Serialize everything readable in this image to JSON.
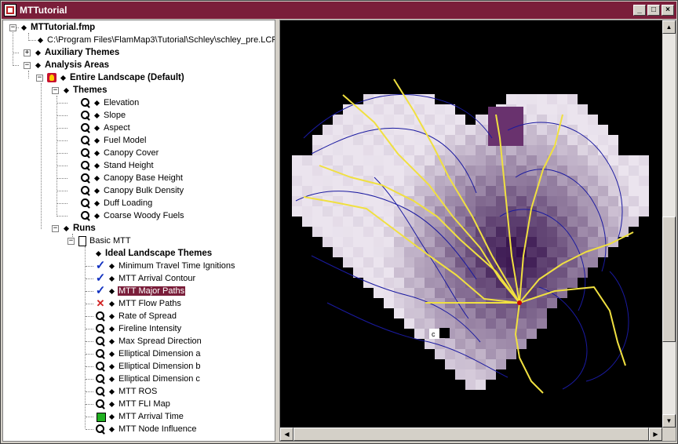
{
  "window": {
    "title": "MTTutorial",
    "controls": {
      "minimize": "_",
      "maximize": "□",
      "close": "×"
    }
  },
  "tree": {
    "root": "MTTutorial.fmp",
    "lcp_path": "C:\\Program Files\\FlamMap3\\Tutorial\\Schley\\schley_pre.LCP",
    "auxiliary_themes": "Auxiliary Themes",
    "analysis_areas": "Analysis Areas",
    "entire_landscape": "Entire Landscape (Default)",
    "themes_label": "Themes",
    "themes": [
      "Elevation",
      "Slope",
      "Aspect",
      "Fuel Model",
      "Canopy Cover",
      "Stand Height",
      "Canopy Base Height",
      "Canopy Bulk Density",
      "Duff Loading",
      "Coarse Woody Fuels"
    ],
    "runs_label": "Runs",
    "run_name": "Basic MTT",
    "ideal_label": "Ideal Landscape Themes",
    "outputs": [
      {
        "label": "Minimum Travel Time Ignitions",
        "icon": "check-icon"
      },
      {
        "label": "MTT Arrival Contour",
        "icon": "check-icon"
      },
      {
        "label": "MTT Major Paths",
        "icon": "check-icon",
        "selected": true
      },
      {
        "label": "MTT Flow Paths",
        "icon": "cross-icon"
      },
      {
        "label": "Rate of Spread",
        "icon": "magnifier-icon"
      },
      {
        "label": "Fireline Intensity",
        "icon": "magnifier-icon"
      },
      {
        "label": "Max Spread Direction",
        "icon": "magnifier-icon"
      },
      {
        "label": "Elliptical Dimension a",
        "icon": "magnifier-icon"
      },
      {
        "label": "Elliptical Dimension b",
        "icon": "magnifier-icon"
      },
      {
        "label": "Elliptical Dimension c",
        "icon": "magnifier-icon"
      },
      {
        "label": "MTT ROS",
        "icon": "magnifier-icon"
      },
      {
        "label": "MTT FLI Map",
        "icon": "magnifier-icon"
      },
      {
        "label": "MTT Arrival Time",
        "icon": "green-square-icon"
      },
      {
        "label": "MTT Node Influence",
        "icon": "magnifier-icon"
      }
    ]
  },
  "map": {
    "colors": {
      "background": "#000000",
      "path": "#f0e040",
      "contour": "#1a1aa0",
      "ignition": "#cc0000"
    },
    "marker_label": "c"
  }
}
